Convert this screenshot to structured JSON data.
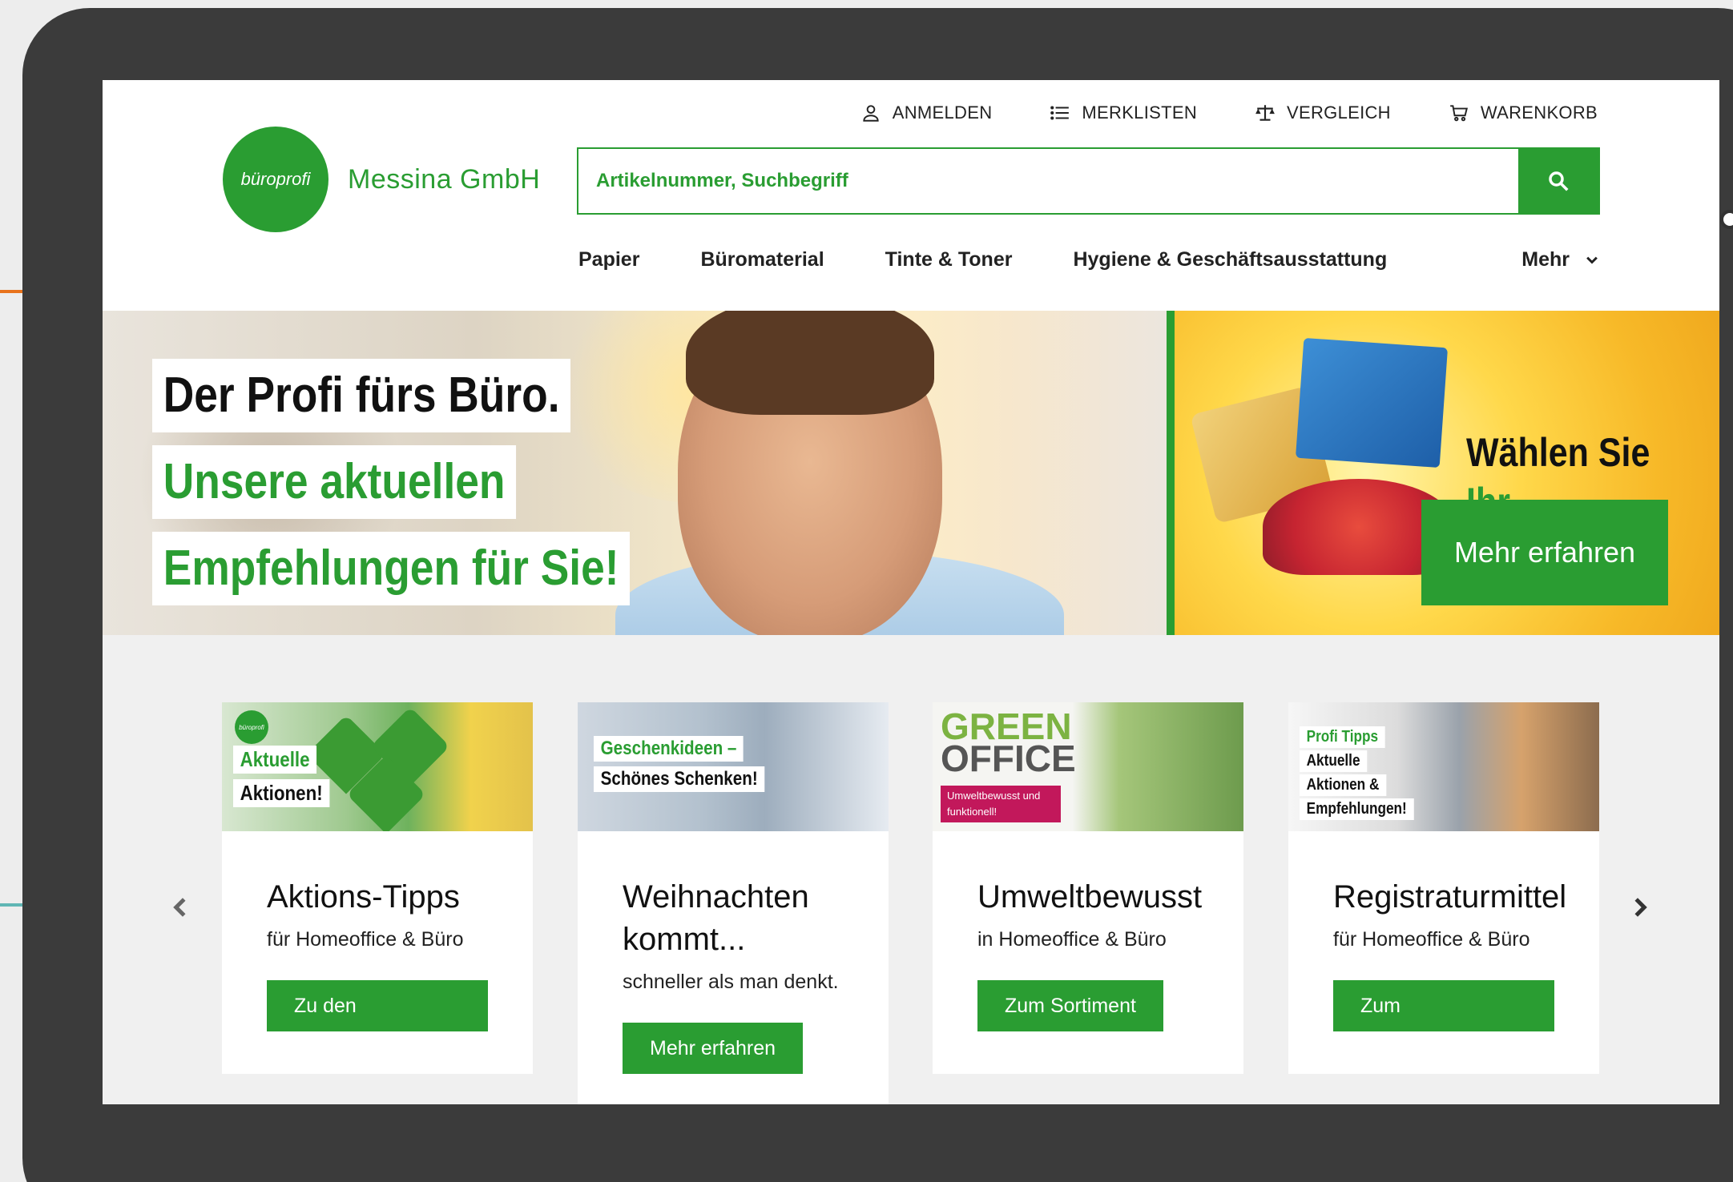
{
  "header": {
    "top_nav": [
      {
        "label": "ANMELDEN",
        "icon": "user-icon"
      },
      {
        "label": "MERKLISTEN",
        "icon": "list-icon"
      },
      {
        "label": "VERGLEICH",
        "icon": "scale-icon"
      },
      {
        "label": "WARENKORB",
        "icon": "cart-icon"
      }
    ],
    "logo_mark": "büroprofi",
    "logo_text": "Messina GmbH",
    "search_placeholder": "Artikelnummer, Suchbegriff",
    "categories": [
      "Papier",
      "Büromaterial",
      "Tinte & Toner",
      "Hygiene & Geschäftsausstattung"
    ],
    "more_label": "Mehr"
  },
  "hero": {
    "line1": "Der Profi fürs Büro.",
    "line2": "Unsere aktuellen",
    "line3": "Empfehlungen für Sie!",
    "side_title": "Wählen Sie",
    "side_title_2": "Ihr Geschenk!",
    "side_button": "Mehr erfahren"
  },
  "cards": [
    {
      "image_badge_1": "Aktuelle",
      "image_badge_2": "Aktionen!",
      "title": "Aktions-Tipps",
      "subtitle": "für Homeoffice & Büro",
      "button": "Zu den Empfehlungen"
    },
    {
      "image_badge_1": "Geschenkideen –",
      "image_badge_2": "Schönes Schenken!",
      "title": "Weihnachten kommt...",
      "subtitle": "schneller als man denkt.",
      "button": "Mehr erfahren"
    },
    {
      "image_badge_1": "GREEN",
      "image_badge_2": "OFFICE",
      "image_tag": "Umweltbewusst und funktionell!",
      "title": "Umweltbewusst",
      "subtitle": "in Homeoffice & Büro",
      "button": "Zum Sortiment"
    },
    {
      "image_badge_1": "Profi Tipps",
      "image_badge_2": "Aktuelle",
      "image_badge_3": "Aktionen &",
      "image_badge_4": "Empfehlungen!",
      "title": "Registraturmittel",
      "subtitle": "für Homeoffice & Büro",
      "button": "Zum Aktionssortiment"
    }
  ],
  "colors": {
    "brand_green": "#2a9d32",
    "tablet_frame": "#3b3b3b",
    "card_area_bg": "#f0f0f0"
  }
}
